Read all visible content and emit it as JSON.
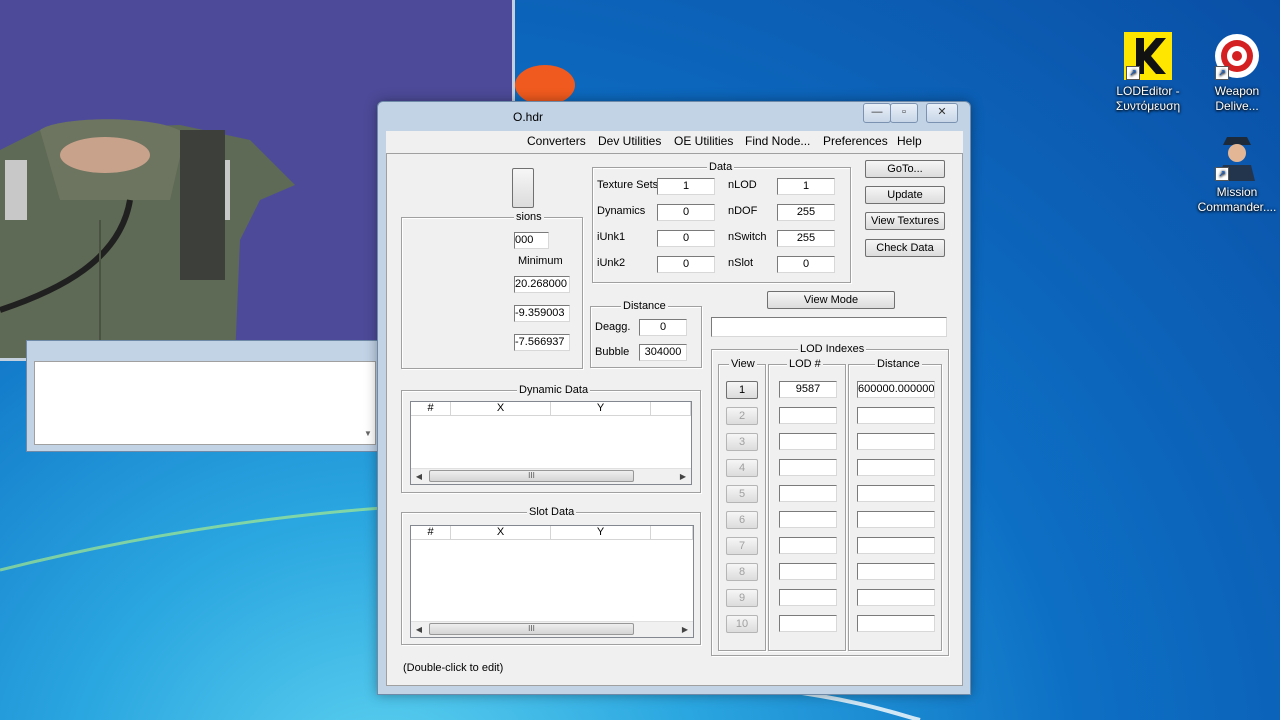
{
  "desktop": {
    "icons": [
      {
        "label": "LODEditor - Συντόμευση",
        "icon": "lodeditor-k-icon"
      },
      {
        "label": "Weapon Delive...",
        "icon": "target-icon"
      },
      {
        "label": "Mission Commander....",
        "icon": "pilot-icon"
      }
    ]
  },
  "window": {
    "title": "O.hdr",
    "menu": [
      "Converters",
      "Dev Utilities",
      "OE Utilities",
      "Find Node...",
      "Preferences",
      "Help"
    ],
    "side_buttons": [
      "GoTo...",
      "Update",
      "View Textures",
      "Check Data"
    ],
    "data_group": {
      "label": "Data",
      "fields": [
        {
          "label": "Texture Sets",
          "value": "1"
        },
        {
          "label": "nLOD",
          "value": "1"
        },
        {
          "label": "Dynamics",
          "value": "0"
        },
        {
          "label": "nDOF",
          "value": "255"
        },
        {
          "label": "iUnk1",
          "value": "0"
        },
        {
          "label": "nSwitch",
          "value": "255"
        },
        {
          "label": "iUnk2",
          "value": "0"
        },
        {
          "label": "nSlot",
          "value": "0"
        }
      ]
    },
    "dimensions_group": {
      "label": "sions",
      "minimum_label": "Minimum",
      "values": [
        "000",
        "20.268000",
        "-9.359003",
        "-7.566937"
      ]
    },
    "distance_group": {
      "label": "Distance",
      "deagg_label": "Deagg.",
      "deagg_value": "0",
      "bubble_label": "Bubble",
      "bubble_value": "304000"
    },
    "view_mode_button": "View Mode",
    "lod_group": {
      "label": "LOD Indexes",
      "col_view": "View",
      "col_lod": "LOD #",
      "col_distance": "Distance",
      "rows": [
        {
          "n": "1",
          "lod": "9587",
          "distance": "600000.000000"
        },
        {
          "n": "2",
          "lod": "",
          "distance": ""
        },
        {
          "n": "3",
          "lod": "",
          "distance": ""
        },
        {
          "n": "4",
          "lod": "",
          "distance": ""
        },
        {
          "n": "5",
          "lod": "",
          "distance": ""
        },
        {
          "n": "6",
          "lod": "",
          "distance": ""
        },
        {
          "n": "7",
          "lod": "",
          "distance": ""
        },
        {
          "n": "8",
          "lod": "",
          "distance": ""
        },
        {
          "n": "9",
          "lod": "",
          "distance": ""
        },
        {
          "n": "10",
          "lod": "",
          "distance": ""
        }
      ]
    },
    "dynamic_group": {
      "label": "Dynamic Data",
      "cols": [
        "#",
        "X",
        "Y"
      ]
    },
    "slot_group": {
      "label": "Slot Data",
      "cols": [
        "#",
        "X",
        "Y"
      ]
    },
    "scroll_thumb": "III",
    "status": "(Double-click to edit)"
  }
}
